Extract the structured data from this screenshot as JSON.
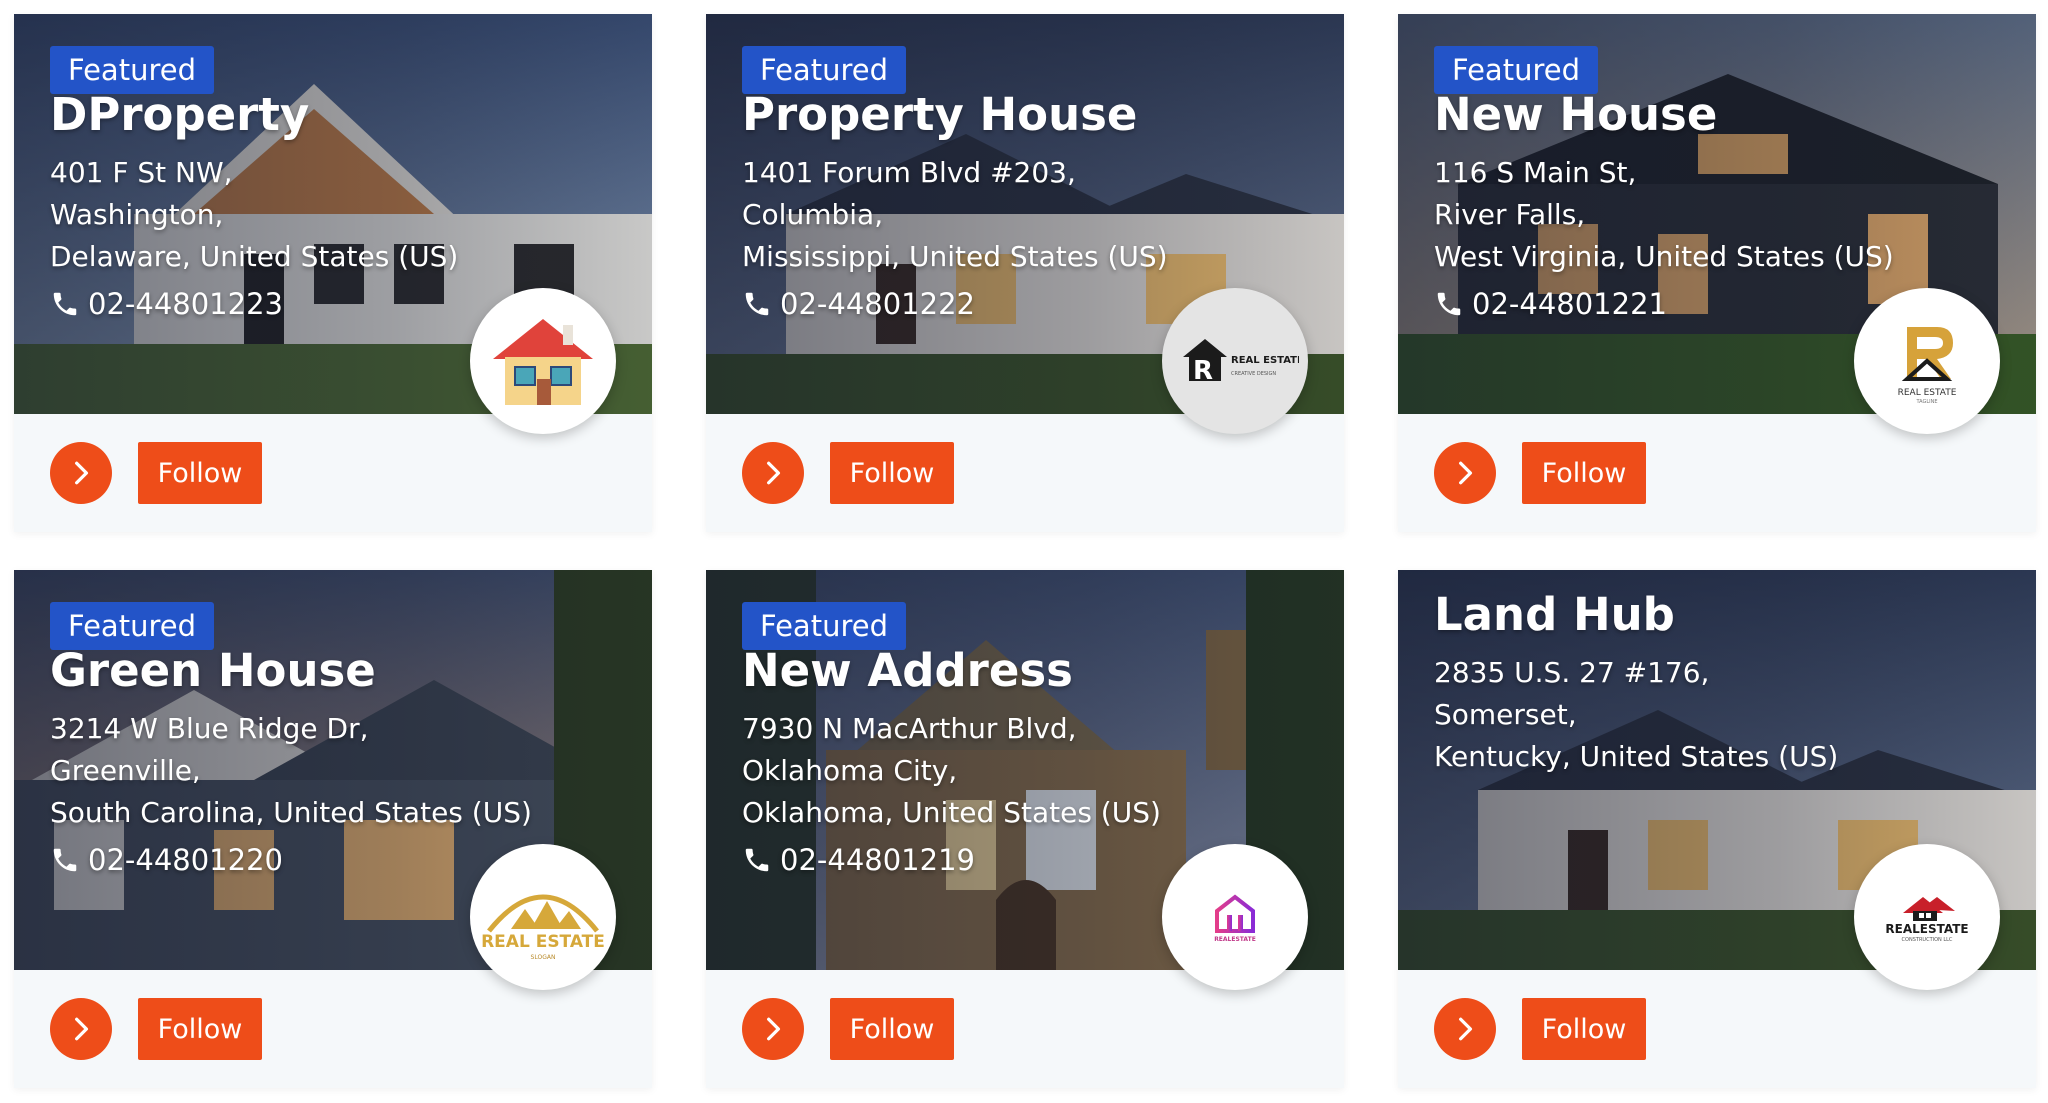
{
  "cards": [
    {
      "badge": "Featured",
      "title": "DProperty",
      "address": [
        "401 F St NW,",
        "Washington,",
        "Delaware, United States (US)"
      ],
      "phone": "02-44801223",
      "follow_label": "Follow"
    },
    {
      "badge": "Featured",
      "title": "Property House",
      "address": [
        "1401 Forum Blvd #203,",
        "Columbia,",
        "Mississippi, United States (US)"
      ],
      "phone": "02-44801222",
      "follow_label": "Follow",
      "logo_text": [
        "REAL ESTATE",
        "CREATIVE DESIGN"
      ]
    },
    {
      "badge": "Featured",
      "title": "New House",
      "address": [
        "116 S Main St,",
        "River Falls,",
        "West Virginia, United States (US)"
      ],
      "phone": "02-44801221",
      "follow_label": "Follow",
      "logo_text": [
        "REAL ESTATE",
        "TAGLINE"
      ]
    },
    {
      "badge": "Featured",
      "title": "Green House",
      "address": [
        "3214 W Blue Ridge Dr,",
        "Greenville,",
        "South Carolina, United States (US)"
      ],
      "phone": "02-44801220",
      "follow_label": "Follow",
      "logo_text": [
        "REAL ESTATE",
        "SLOGAN"
      ]
    },
    {
      "badge": "Featured",
      "title": "New Address",
      "address": [
        "7930 N MacArthur Blvd,",
        "Oklahoma City,",
        "Oklahoma, United States (US)"
      ],
      "phone": "02-44801219",
      "follow_label": "Follow",
      "logo_text": [
        "REALESTATE"
      ]
    },
    {
      "title": "Land Hub",
      "address": [
        "2835 U.S. 27 #176,",
        "Somerset,",
        "Kentucky, United States (US)"
      ],
      "follow_label": "Follow",
      "logo_text": [
        "REALESTATE",
        "CONSTRUCTION LLC"
      ]
    }
  ],
  "colors": {
    "accent": "#ee4d19",
    "badge": "#2354c8",
    "card_bg": "#f5f8fa"
  },
  "icons": {
    "phone": "phone-icon",
    "go": "chevron-right-icon"
  }
}
